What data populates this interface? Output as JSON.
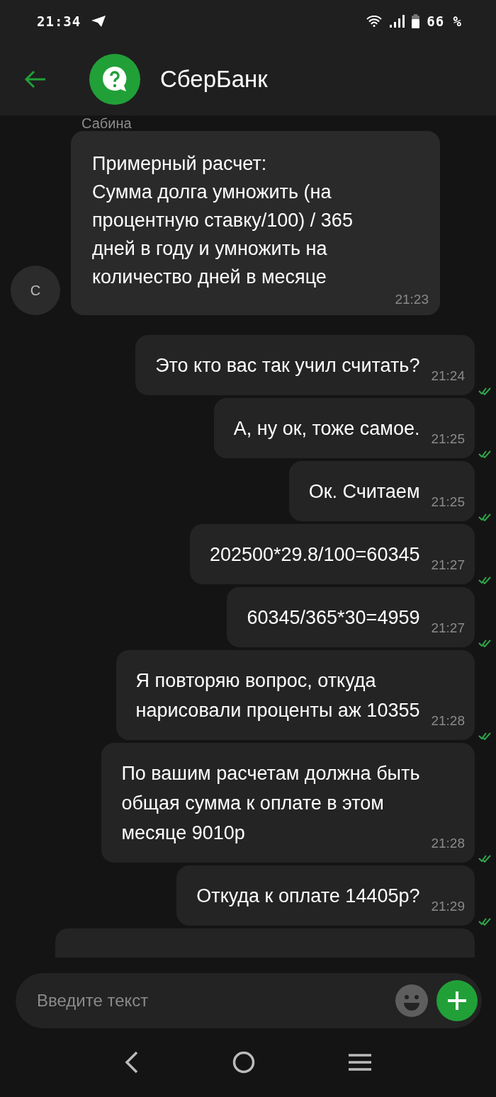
{
  "status_bar": {
    "time": "21:34",
    "battery": "66 %"
  },
  "header": {
    "title": "СберБанк"
  },
  "chat": {
    "sender": "Сабина",
    "avatar_letter": "С",
    "messages": [
      {
        "kind": "incoming",
        "text": "Примерный расчет:\nСумма долга умножить (на\nпроцентную ставку/100) / 365\nдней в году и умножить на\nколичество дней в месяце",
        "time": "21:23"
      },
      {
        "kind": "outgoing",
        "text": "Это кто вас так учил считать?",
        "time": "21:24",
        "read": true
      },
      {
        "kind": "outgoing",
        "text": "А, ну ок, тоже самое.",
        "time": "21:25",
        "read": true
      },
      {
        "kind": "outgoing",
        "text": "Ок. Считаем",
        "time": "21:25",
        "read": true
      },
      {
        "kind": "outgoing",
        "text": "202500*29.8/100=60345",
        "time": "21:27",
        "read": true
      },
      {
        "kind": "outgoing",
        "text": "60345/365*30=4959",
        "time": "21:27",
        "read": true
      },
      {
        "kind": "outgoing",
        "text": "Я повторяю вопрос, откуда\nнарисовали проценты аж 10355",
        "time": "21:28",
        "read": true
      },
      {
        "kind": "outgoing",
        "text": "По вашим расчетам должна быть\nобщая сумма к оплате в этом\nмесяце 9010р",
        "time": "21:28",
        "read": true
      },
      {
        "kind": "outgoing",
        "text": "Откуда к оплате 14405р?",
        "time": "21:29",
        "read": true
      },
      {
        "kind": "outgoing_cut"
      }
    ]
  },
  "input": {
    "placeholder": "Введите текст"
  }
}
